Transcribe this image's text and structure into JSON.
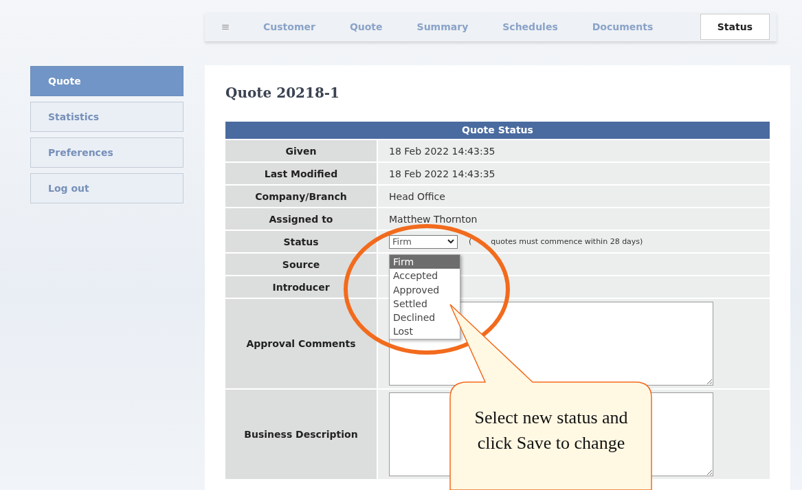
{
  "menu_icon": "≡",
  "tabs": [
    {
      "label": "Customer",
      "selected": false
    },
    {
      "label": "Quote",
      "selected": false
    },
    {
      "label": "Summary",
      "selected": false
    },
    {
      "label": "Schedules",
      "selected": false
    },
    {
      "label": "Documents",
      "selected": false
    },
    {
      "label": "Status",
      "selected": true
    }
  ],
  "sidebar": {
    "items": [
      {
        "label": "Quote",
        "selected": true
      },
      {
        "label": "Statistics",
        "selected": false
      },
      {
        "label": "Preferences",
        "selected": false
      },
      {
        "label": "Log out",
        "selected": false
      }
    ]
  },
  "title": "Quote 20218-1",
  "table": {
    "title": "Quote Status",
    "rows": [
      {
        "kind": "text",
        "label": "Given",
        "value": "18 Feb 2022 14:43:35"
      },
      {
        "kind": "text",
        "label": "Last Modified",
        "value": "18 Feb 2022 14:43:35"
      },
      {
        "kind": "text",
        "label": "Company/Branch",
        "value": "Head Office"
      },
      {
        "kind": "text",
        "label": "Assigned to",
        "value": "Matthew Thornton"
      },
      {
        "kind": "select",
        "label": "Status",
        "value": "Firm",
        "note_open": "(",
        "note": "quotes must commence within 28 days)"
      },
      {
        "kind": "empty",
        "label": "Source"
      },
      {
        "kind": "empty",
        "label": "Introducer"
      },
      {
        "kind": "textarea",
        "label": "Approval Comments"
      },
      {
        "kind": "textarea",
        "label": "Business Description"
      }
    ]
  },
  "dropdown": {
    "options": [
      {
        "label": "Firm",
        "selected": true
      },
      {
        "label": "Accepted",
        "selected": false
      },
      {
        "label": "Approved",
        "selected": false
      },
      {
        "label": "Settled",
        "selected": false
      },
      {
        "label": "Declined",
        "selected": false
      },
      {
        "label": "Lost",
        "selected": false
      }
    ]
  },
  "callout": {
    "text": "Select new status and click Save to change"
  }
}
